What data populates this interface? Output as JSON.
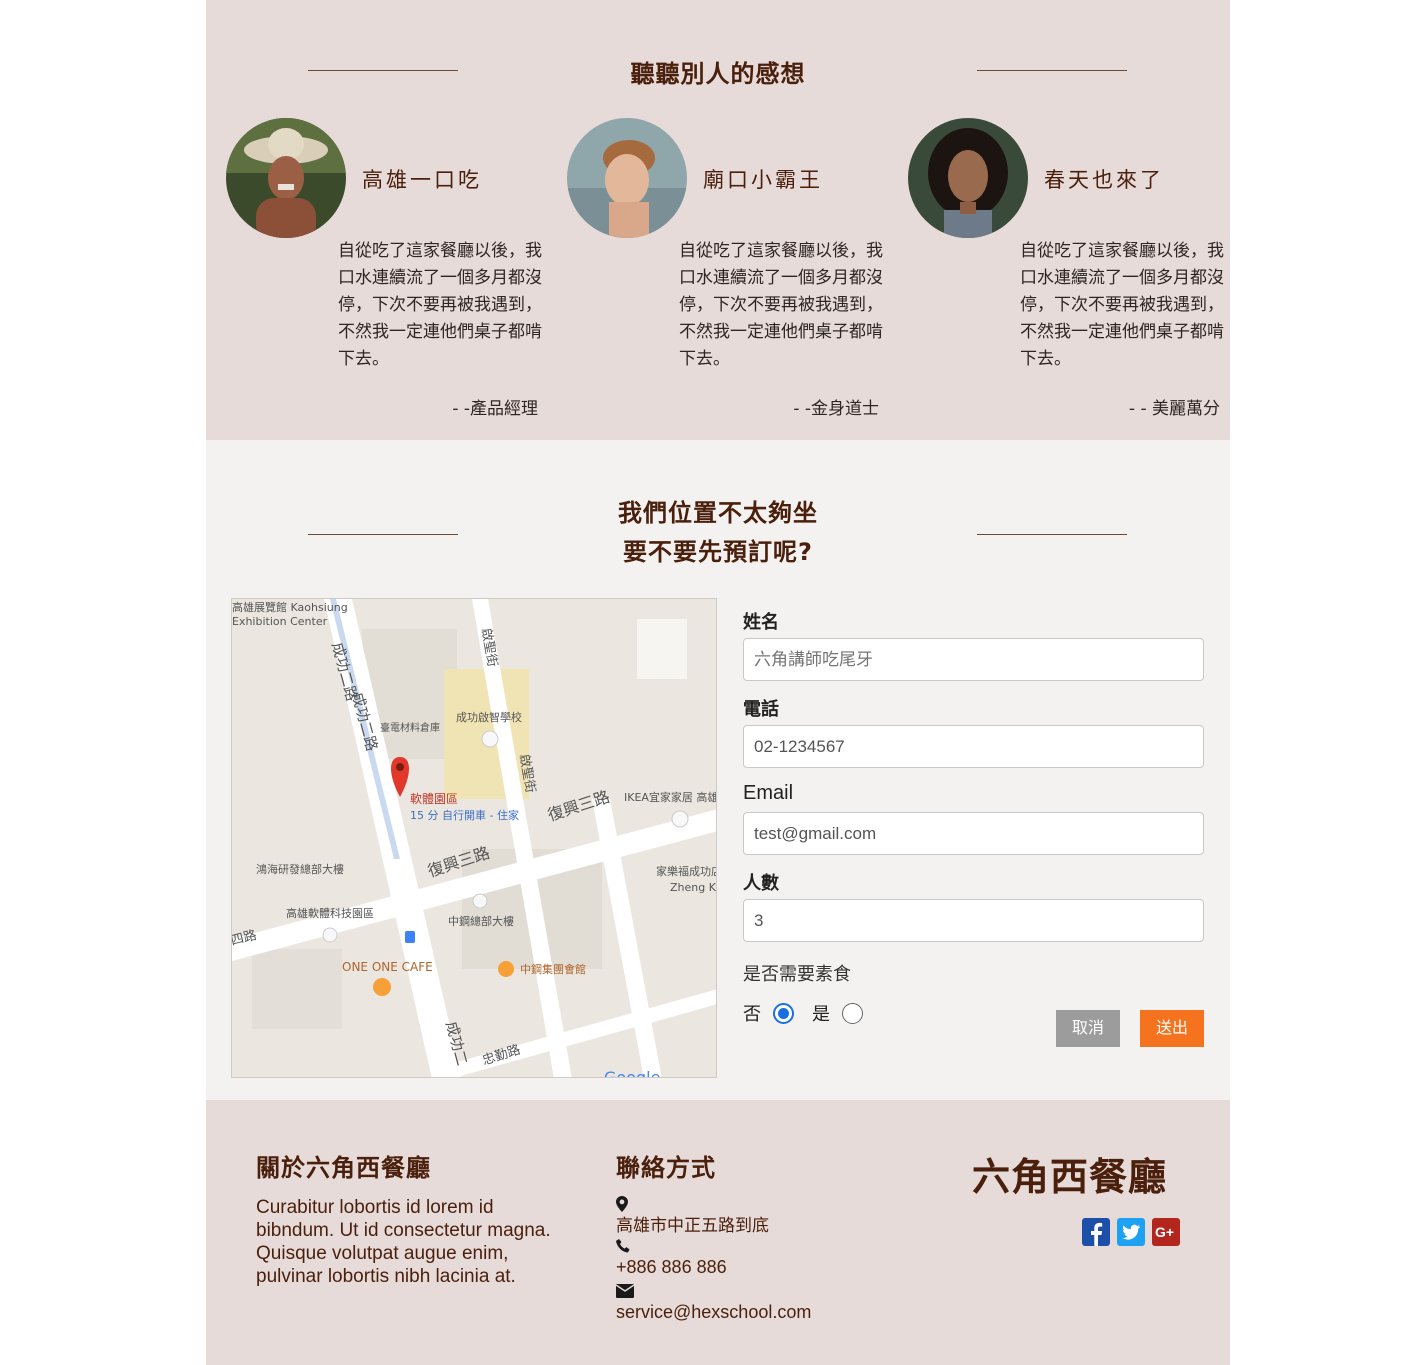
{
  "testimonials": {
    "title": "聽聽別人的感想",
    "cards": [
      {
        "name": "高雄一口吃",
        "text": "自從吃了這家餐廳以後，我口水連續流了一個多月都沒停，下次不要再被我遇到，不然我一定連他們桌子都啃下去。",
        "signature": "- -產品經理"
      },
      {
        "name": "廟口小霸王",
        "text": "自從吃了這家餐廳以後，我口水連續流了一個多月都沒停，下次不要再被我遇到，不然我一定連他們桌子都啃下去。",
        "signature": "- -金身道士"
      },
      {
        "name": "春天也來了",
        "text": "自從吃了這家餐廳以後，我口水連續流了一個多月都沒停，下次不要再被我遇到，不然我一定連他們桌子都啃下去。",
        "signature": "- - 美麗萬分"
      }
    ]
  },
  "reservation": {
    "title_line1": "我們位置不太夠坐",
    "title_line2": "要不要先預訂呢?",
    "map": {
      "labels": [
        "高雄展覽館 Kaohsiung",
        "Exhibition Center",
        "成功二路",
        "成功二路",
        "啟聖街",
        "成功啟智學校",
        "臺電材料倉庫",
        "啟聖街",
        "軟體園區",
        "15 分 自行開車 - 住家",
        "復興三路",
        "IKEA宜家家居 高雄",
        "復興三路",
        "鴻海研發總部大樓",
        "家樂福成功店",
        "Zheng Ko",
        "高雄軟體科技園區",
        "中鋼總部大樓",
        "ONE ONE CAFE",
        "中鋼集團會館",
        "四路",
        "成功二",
        "忠勤路",
        "Google"
      ]
    },
    "form": {
      "name_label": "姓名",
      "name_placeholder": "六角講師吃尾牙",
      "phone_label": "電話",
      "phone_value": "02-1234567",
      "email_label": "Email",
      "email_value": "test@gmail.com",
      "people_label": "人數",
      "people_value": "3",
      "veg_question": "是否需要素食",
      "option_no": "否",
      "option_yes": "是",
      "selected": "否",
      "cancel_label": "取消",
      "submit_label": "送出"
    }
  },
  "footer": {
    "about_title": "關於六角西餐廳",
    "about_text": "Curabitur lobortis id lorem id bibndum. Ut id consectetur magna. Quisque volutpat augue enim, pulvinar lobortis nibh lacinia at.",
    "contact_title": "聯絡方式",
    "address": "高雄市中正五路到底",
    "phone": "+886 886 886",
    "email": "service@hexschool.com",
    "brand": "六角西餐廳",
    "social_icons": [
      "facebook-icon",
      "twitter-icon",
      "google-plus-icon"
    ]
  },
  "colors": {
    "accent": "#f5731f",
    "brand_brown": "#4a1f0c",
    "section_pink": "#e6dbd8",
    "section_light": "#f4f2f0",
    "facebook": "#1b4fa8",
    "twitter": "#1da1f2",
    "google_plus": "#b3261e"
  }
}
